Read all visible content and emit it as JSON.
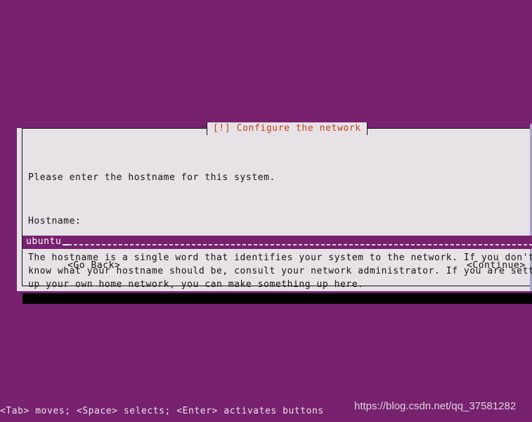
{
  "screen": {
    "background_color": "#77216F",
    "black_bar_color": "#000000"
  },
  "dialog": {
    "title": "[!] Configure the network",
    "title_color": "#C93B1B",
    "background_color": "#E6E2E6",
    "border_color": "#131313",
    "paragraphs": [
      "Please enter the hostname for this system.",
      "The hostname is a single word that identifies your system to the network. If you don't\nknow what your hostname should be, consult your network administrator. If you are setting\nup your own home network, you can make something up here."
    ],
    "hostname_label": "Hostname:",
    "hostname_input": {
      "value": "ubuntu",
      "placeholder": "",
      "selected": true,
      "cursor": "_",
      "field_color": "#77216F",
      "text_color": "#FFFFFF"
    },
    "buttons": {
      "go_back": "<Go Back>",
      "continue": "<Continue>"
    }
  },
  "status_bar": {
    "text": "<Tab> moves; <Space> selects; <Enter> activates buttons"
  },
  "watermark": {
    "text": "https://blog.csdn.net/qq_37581282"
  }
}
